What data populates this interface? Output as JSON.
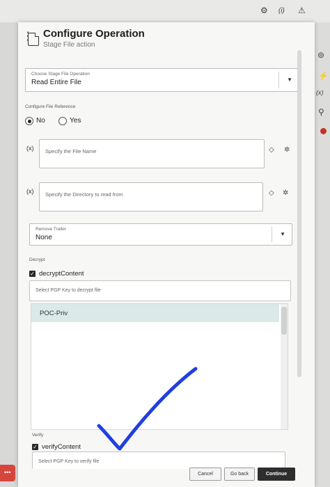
{
  "topbar": {
    "gear_icon": "⚙",
    "info_text": "(i)",
    "warning_icon": "⚠"
  },
  "right_rail": {
    "settings_icon": "⊚",
    "lightning_icon": "⚡",
    "variable_text": "(x)",
    "search_icon": "⚲"
  },
  "header": {
    "title": "Configure Operation",
    "subtitle": "Stage File action"
  },
  "operation": {
    "label": "Choose Stage File Operation",
    "value": "Read Entire File"
  },
  "file_reference": {
    "label": "Configure File Reference",
    "options": [
      "No",
      "Yes"
    ],
    "selected": "No"
  },
  "file_name": {
    "var_marker": "(x)",
    "placeholder": "Specify the File Name"
  },
  "directory": {
    "var_marker": "(x)",
    "placeholder": "Specify the Directory to read from"
  },
  "remove_trailer": {
    "label": "Remove Trailer",
    "value": "None"
  },
  "decrypt": {
    "section_label": "Decrypt",
    "checkbox_label": "decryptContent",
    "search_placeholder": "Select PGP Key to decrypt file",
    "keys": [
      "POC-Priv"
    ]
  },
  "verify": {
    "section_label": "Verify",
    "checkbox_label": "verifyContent",
    "search_placeholder": "Select PGP Key to verify file"
  },
  "footer": {
    "cancel": "Cancel",
    "go_back": "Go back",
    "continue": "Continue"
  },
  "colors": {
    "selected_row": "#dbeae8",
    "primary_button": "#2e2e2e",
    "check_overlay": "#1f3fe0"
  }
}
